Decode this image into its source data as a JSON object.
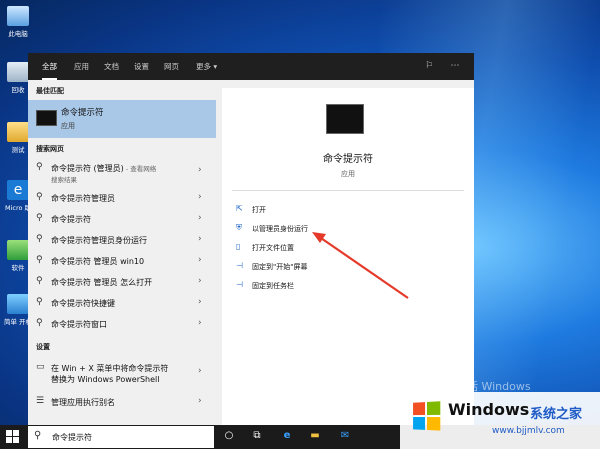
{
  "desktop": {
    "icons": [
      {
        "label": "此电脑"
      },
      {
        "label": "回收"
      },
      {
        "label": "测试"
      },
      {
        "label": "Micro 助"
      },
      {
        "label": "软件"
      },
      {
        "label": "简单 开机"
      }
    ],
    "watermark": "激活 Windows"
  },
  "topbar": {
    "tabs": [
      "全部",
      "应用",
      "文档",
      "设置",
      "网页",
      "更多 ▾"
    ]
  },
  "left": {
    "best_match_title": "最佳匹配",
    "best": {
      "name": "命令提示符",
      "type": "应用"
    },
    "web_title": "搜索网页",
    "web_items": [
      {
        "label": "命令提示符 (管理员)",
        "sub": " - 查看网络",
        "sub2": "搜索结果"
      },
      {
        "label": "命令提示符管理员"
      },
      {
        "label": "命令提示符"
      },
      {
        "label": "命令提示符管理员身份运行"
      },
      {
        "label": "命令提示符 管理员 win10"
      },
      {
        "label": "命令提示符 管理员 怎么打开"
      },
      {
        "label": "命令提示符快捷键"
      },
      {
        "label": "命令提示符窗口"
      }
    ],
    "settings_title": "设置",
    "settings_items": [
      {
        "label": "在 Win + X 菜单中将命令提示符",
        "label2": "替换为 Windows PowerShell"
      },
      {
        "label": "管理应用执行别名"
      }
    ]
  },
  "right": {
    "name": "命令提示符",
    "type": "应用",
    "actions": [
      {
        "label": "打开"
      },
      {
        "label": "以管理员身份运行"
      },
      {
        "label": "打开文件位置"
      },
      {
        "label": "固定到\"开始\"屏幕"
      },
      {
        "label": "固定到任务栏"
      }
    ]
  },
  "taskbar": {
    "search_value": "命令提示符"
  },
  "logo": {
    "title": "Windows",
    "subtitle": "系统之家",
    "url": "www.bjjmlv.com"
  }
}
